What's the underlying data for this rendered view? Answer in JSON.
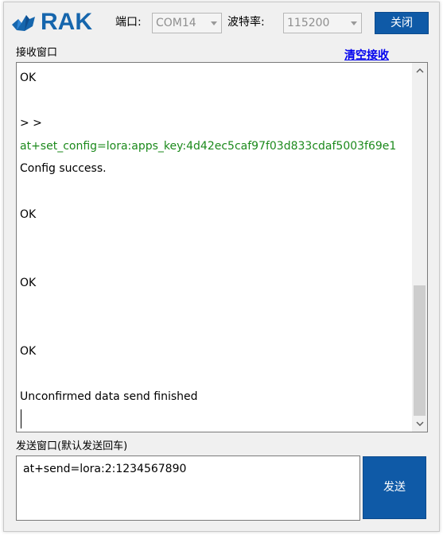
{
  "header": {
    "logo_text": "RAK",
    "port_label": "端口:",
    "port_value": "COM14",
    "baud_label": "波特率:",
    "baud_value": "115200",
    "close_label": "关闭"
  },
  "receive": {
    "title": "接收窗口",
    "clear_label": "清空接收",
    "lines": [
      "OK",
      "> >",
      "at+set_config=lora:apps_key:4d42ec5caf97f03d833cdaf5003f69e1",
      "Config success.",
      "OK",
      "OK",
      "OK",
      "Unconfirmed data send finished"
    ]
  },
  "send": {
    "title": "发送窗口(默认发送回车)",
    "input_value": "at+send=lora:2:1234567890",
    "send_label": "发送"
  },
  "colors": {
    "accent": "#0f5aa7",
    "command_text": "#1c8a1c",
    "link": "#0000ee"
  },
  "icons": [
    "rak-logo-icon",
    "chevron-down-icon",
    "scroll-up-icon",
    "scroll-down-icon"
  ]
}
